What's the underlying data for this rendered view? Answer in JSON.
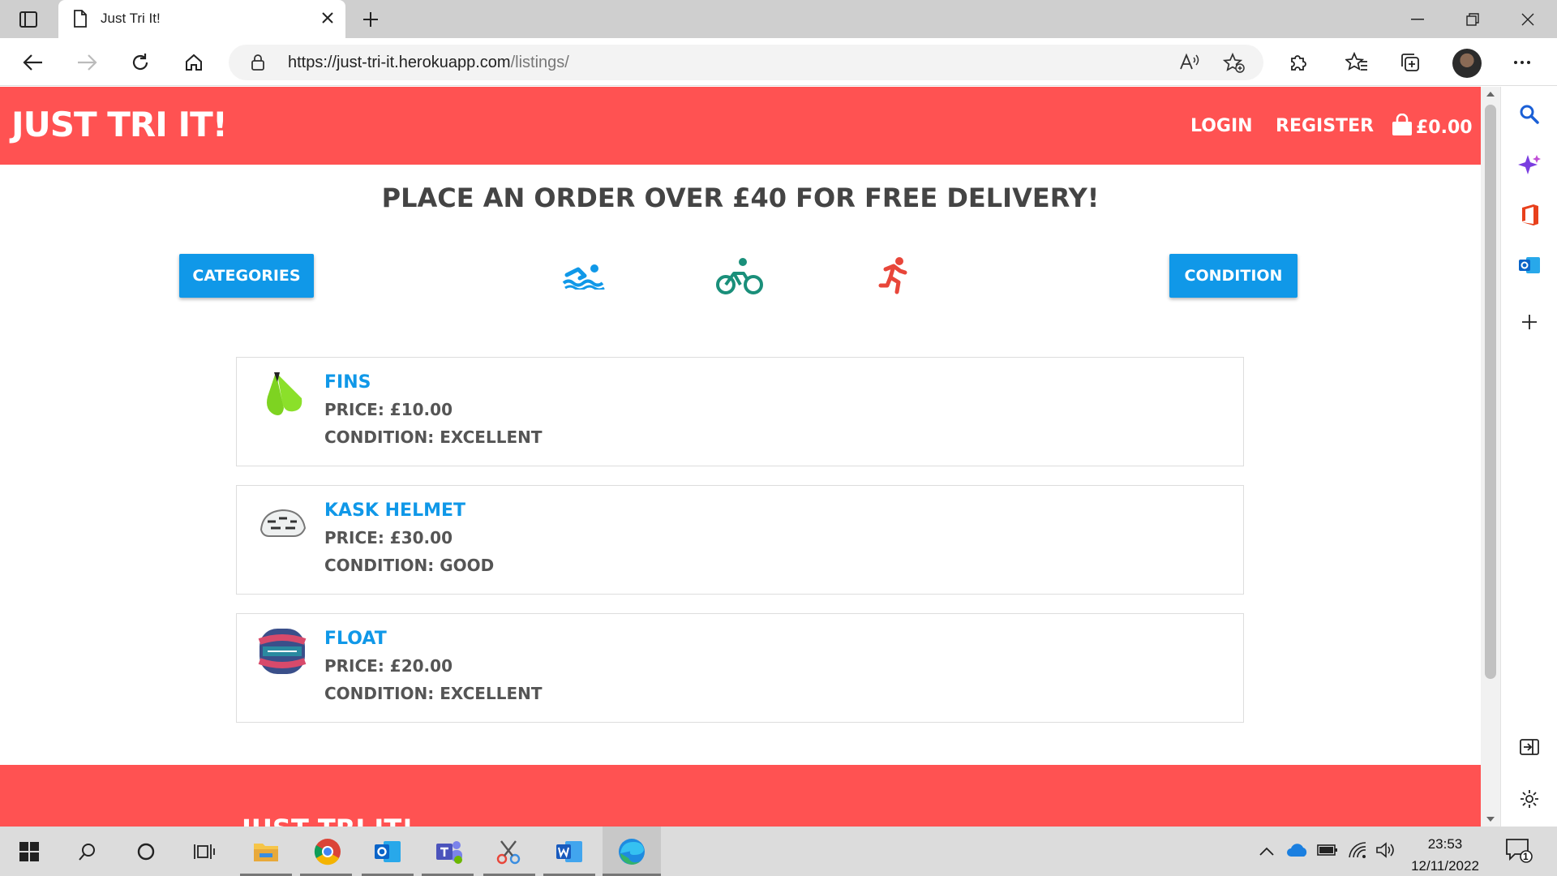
{
  "browser": {
    "tab_title": "Just Tri It!",
    "url_main": "https://just-tri-it.herokuapp.com",
    "url_path": "/listings/"
  },
  "site": {
    "brand": "JUST TRI IT!",
    "nav": {
      "login": "LOGIN",
      "register": "REGISTER",
      "basket_total": "£0.00"
    },
    "promo": "PLACE AN ORDER OVER £40 FOR FREE DELIVERY!",
    "buttons": {
      "categories": "CATEGORIES",
      "condition": "CONDITION"
    },
    "sports": [
      "swim-icon",
      "bike-icon",
      "run-icon"
    ],
    "listings": [
      {
        "name": "FINS",
        "price": "PRICE: £10.00",
        "condition": "CONDITION: EXCELLENT"
      },
      {
        "name": "KASK HELMET",
        "price": "PRICE: £30.00",
        "condition": "CONDITION: GOOD"
      },
      {
        "name": "FLOAT",
        "price": "PRICE: £20.00",
        "condition": "CONDITION: EXCELLENT"
      }
    ],
    "footer_brand": "JUST TRI IT!"
  },
  "colors": {
    "brand_red": "#ff5252",
    "accent_blue": "#1098e8",
    "swim": "#1098e8",
    "bike": "#1a8f7a",
    "run": "#e8463a"
  },
  "taskbar": {
    "time": "23:53",
    "date": "12/11/2022",
    "notifications": "1"
  }
}
